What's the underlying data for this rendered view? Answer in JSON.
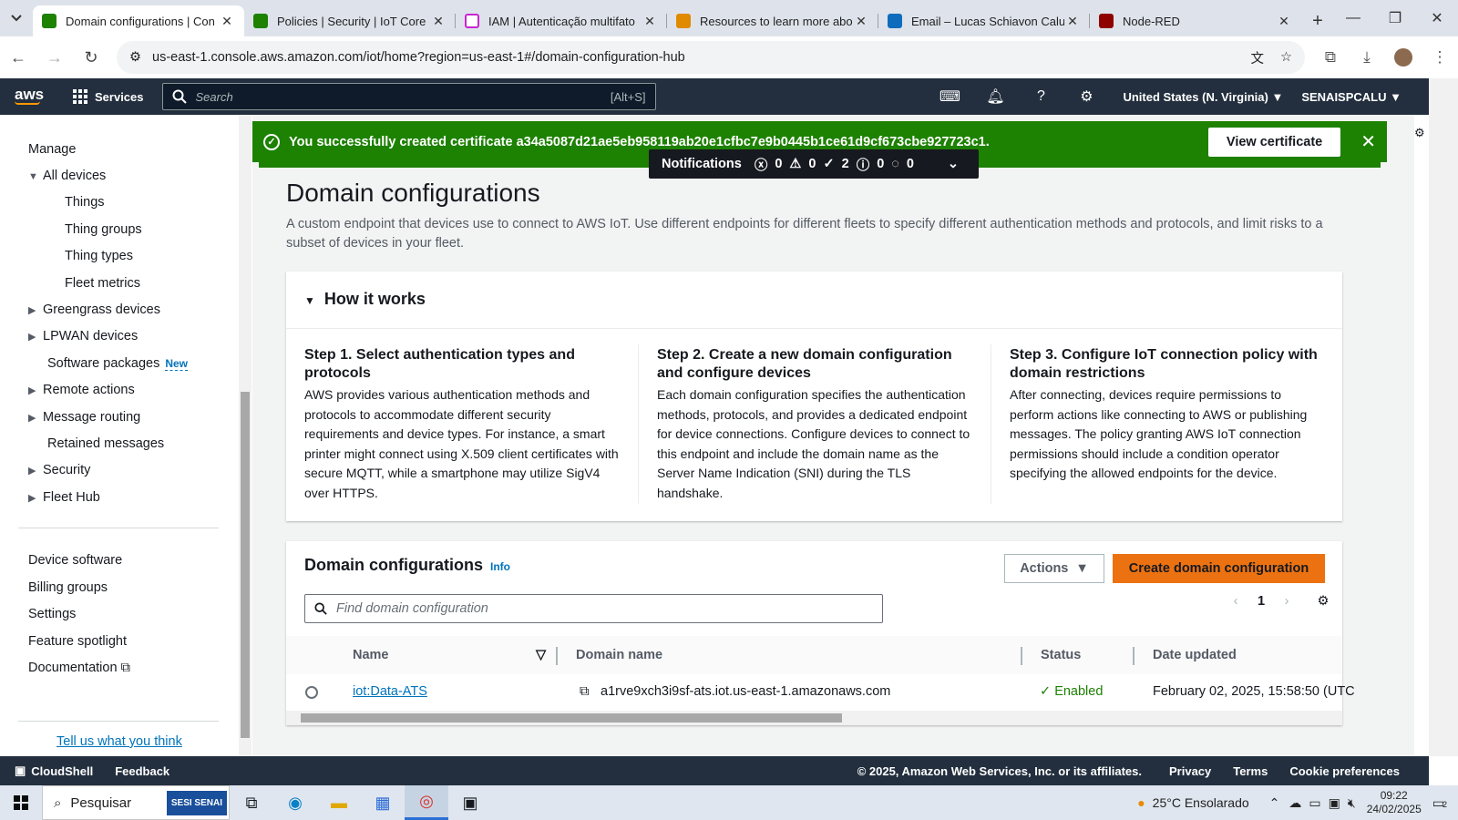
{
  "browser": {
    "tabs": [
      {
        "title": "Domain configurations | Con",
        "color": "#1d8102",
        "active": true
      },
      {
        "title": "Policies | Security | IoT Core |",
        "color": "#1d8102",
        "active": false
      },
      {
        "title": "IAM | Autenticação multifato",
        "color": "#c925d1",
        "active": false
      },
      {
        "title": "Resources to learn more abo",
        "color": "#e08a00",
        "active": false
      },
      {
        "title": "Email – Lucas Schiavon Calu",
        "color": "#0f6cbd",
        "active": false
      },
      {
        "title": "Node-RED",
        "color": "#8f0000",
        "active": false
      }
    ],
    "url": "us-east-1.console.aws.amazon.com/iot/home?region=us-east-1#/domain-configuration-hub"
  },
  "aws": {
    "logo": "aws",
    "services": "Services",
    "search_placeholder": "Search",
    "search_shortcut": "[Alt+S]",
    "region": "United States (N. Virginia)",
    "account": "SENAISPCALU"
  },
  "sidebar": {
    "manage": "Manage",
    "all_devices": "All devices",
    "things": "Things",
    "thing_groups": "Thing groups",
    "thing_types": "Thing types",
    "fleet_metrics": "Fleet metrics",
    "greengrass": "Greengrass devices",
    "lpwan": "LPWAN devices",
    "software_packages": "Software packages",
    "new_badge": "New",
    "remote_actions": "Remote actions",
    "message_routing": "Message routing",
    "retained_messages": "Retained messages",
    "security": "Security",
    "fleet_hub": "Fleet Hub",
    "device_software": "Device software",
    "billing_groups": "Billing groups",
    "settings": "Settings",
    "feature_spotlight": "Feature spotlight",
    "documentation": "Documentation",
    "tell_us": "Tell us what you think"
  },
  "flash": {
    "message": "You successfully created certificate a34a5087d21ae5eb958119ab20e1cfbc7e9b0445b1ce61d9cf673cbe927723c1.",
    "view_button": "View certificate"
  },
  "notifications": {
    "label": "Notifications",
    "error": "0",
    "warning": "0",
    "success": "2",
    "info": "0",
    "progress": "0"
  },
  "page": {
    "title": "Domain configurations",
    "description": "A custom endpoint that devices use to connect to AWS IoT. Use different endpoints for different fleets to specify different authentication methods and protocols, and limit risks to a subset of devices in your fleet."
  },
  "how_it_works": {
    "title": "How it works",
    "steps": [
      {
        "title": "Step 1. Select authentication types and protocols",
        "body": "AWS provides various authentication methods and protocols to accommodate different security requirements and device types. For instance, a smart printer might connect using X.509 client certificates with secure MQTT, while a smartphone may utilize SigV4 over HTTPS."
      },
      {
        "title": "Step 2. Create a new domain configuration and configure devices",
        "body": "Each domain configuration specifies the authentication methods, protocols, and provides a dedicated endpoint for device connections. Configure devices to connect to this endpoint and include the domain name as the Server Name Indication (SNI) during the TLS handshake."
      },
      {
        "title": "Step 3. Configure IoT connection policy with domain restrictions",
        "body": "After connecting, devices require permissions to perform actions like connecting to AWS or publishing messages. The policy granting AWS IoT connection permissions should include a condition operator specifying the allowed endpoints for the device."
      }
    ]
  },
  "domain_table": {
    "title": "Domain configurations",
    "info": "Info",
    "actions": "Actions",
    "create": "Create domain configuration",
    "search_placeholder": "Find domain configuration",
    "page": "1",
    "headers": {
      "name": "Name",
      "domain": "Domain name",
      "status": "Status",
      "date": "Date updated"
    },
    "rows": [
      {
        "name": "iot:Data-ATS",
        "domain": "a1rve9xch3i9sf-ats.iot.us-east-1.amazonaws.com",
        "status": "Enabled",
        "date": "February 02, 2025, 15:58:50 (UTC"
      }
    ]
  },
  "footer": {
    "cloudshell": "CloudShell",
    "feedback": "Feedback",
    "copyright": "© 2025, Amazon Web Services, Inc. or its affiliates.",
    "privacy": "Privacy",
    "terms": "Terms",
    "cookies": "Cookie preferences"
  },
  "taskbar": {
    "search": "Pesquisar",
    "sesi": "SESI SENAI",
    "weather": "25°C Ensolarado",
    "time": "09:22",
    "date": "24/02/2025",
    "notif_count": "2"
  }
}
